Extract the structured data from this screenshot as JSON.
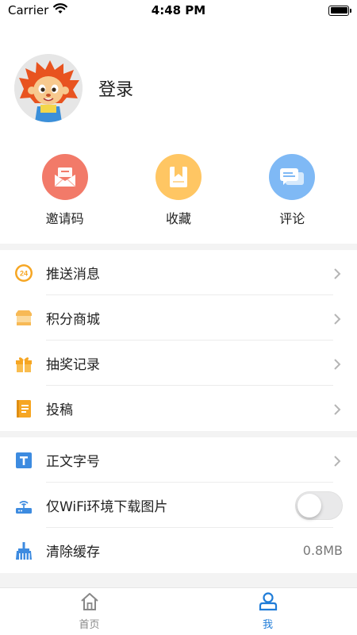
{
  "status_bar": {
    "carrier": "Carrier",
    "time": "4:48 PM"
  },
  "profile": {
    "login_label": "登录"
  },
  "quick_actions": [
    {
      "label": "邀请码",
      "color": "#F27A69",
      "icon": "envelope-icon"
    },
    {
      "label": "收藏",
      "color": "#FFC663",
      "icon": "bookmark-icon"
    },
    {
      "label": "评论",
      "color": "#7FB9F5",
      "icon": "chat-bubble-icon"
    }
  ],
  "menu_group_1": [
    {
      "label": "推送消息",
      "icon": "clock-24-icon"
    },
    {
      "label": "积分商城",
      "icon": "shop-icon"
    },
    {
      "label": "抽奖记录",
      "icon": "gift-icon"
    },
    {
      "label": "投稿",
      "icon": "notebook-icon"
    }
  ],
  "menu_group_2": [
    {
      "label": "正文字号",
      "icon": "font-size-icon"
    },
    {
      "label": "仅WiFi环境下载图片",
      "icon": "router-icon"
    },
    {
      "label": "清除缓存",
      "icon": "broom-icon",
      "value": "0.8MB"
    }
  ],
  "wifi_only_toggle": {
    "on": false
  },
  "tab_bar": {
    "tabs": [
      {
        "label": "首页",
        "icon": "home-icon",
        "active": false
      },
      {
        "label": "我",
        "icon": "user-icon",
        "active": true
      }
    ],
    "active_color": "#1F7CD8",
    "inactive_color": "#888888"
  }
}
